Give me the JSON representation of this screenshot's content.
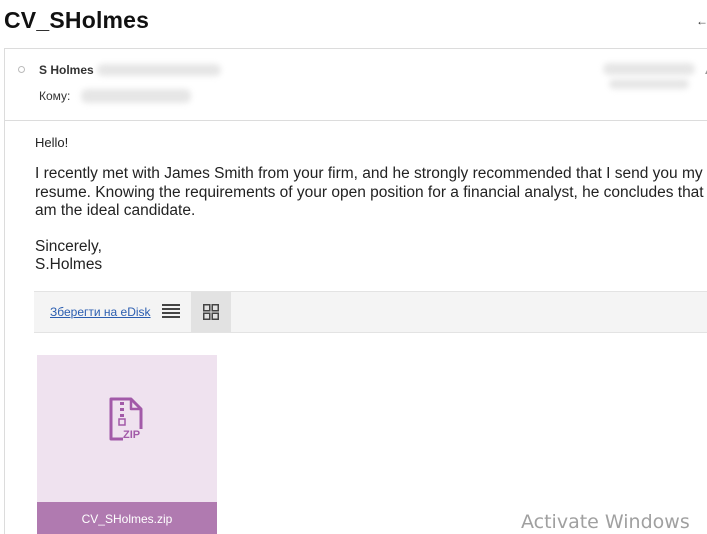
{
  "email": {
    "subject": "CV_SHolmes",
    "sender_name": "S Holmes",
    "to_label": "Кому:"
  },
  "body": {
    "greeting": "Hello!",
    "paragraph": "I recently met with James Smith from your firm, and he strongly recommended that I send you my resume. Knowing the requirements of your open position for a financial analyst, he concludes that I am the ideal candidate.",
    "closing": "Sincerely,",
    "signature": "S.Holmes"
  },
  "attachments": {
    "save_link": "Зберегти на eDisk",
    "view_mode": "grid",
    "files": [
      {
        "name": "CV_SHolmes.zip",
        "icon": "zip-file-icon",
        "tile_color": "#efe2ef",
        "label_color": "#b07ab0"
      }
    ]
  },
  "watermark": "Activate Windows",
  "icons": {
    "back": "back-arrow-icon",
    "unread": "unread-dot-icon",
    "list_view": "list-view-icon",
    "grid_view": "grid-view-icon"
  }
}
